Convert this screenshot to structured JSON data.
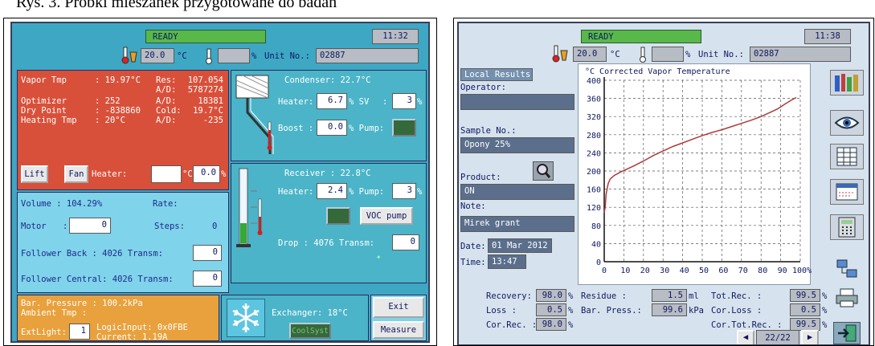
{
  "caption": "Rys. 3. Próbki mieszanek przygotowane do badań",
  "left_screen": {
    "status": "READY",
    "time": "11:32",
    "temperature": "20.0",
    "temp_unit": "°C",
    "humidity_unit": "%",
    "unit_no_label": "Unit No.:",
    "unit_no": "02887",
    "red_panel": {
      "rows": [
        {
          "label": "Vapor Tmp",
          "v1": ": 19.97°C",
          "k2": "Res:",
          "v2": "107.054"
        },
        {
          "label": "",
          "v1": "",
          "k2": "A/D:",
          "v2": "5787274"
        },
        {
          "label": "Optimizer",
          "v1": ": 252",
          "k2": "A/D:",
          "v2": "18381"
        },
        {
          "label": "Dry Point",
          "v1": ": -838860",
          "k2": "Cold:",
          "v2": "19.7°C"
        },
        {
          "label": "Heating Tmp",
          "v1": ": 20°C",
          "k2": "A/D:",
          "v2": "-235"
        }
      ],
      "lift_label": "Lift",
      "fan_label": "Fan",
      "heater_label": "Heater:",
      "heater_value": "",
      "heater_unit": "°C",
      "heater_pct": "0.0",
      "pct_unit": "%"
    },
    "condenser": {
      "title": "Condenser: 22.7°C",
      "heater_label": "Heater:",
      "heater_value": "6.7",
      "sv_label": "% SV",
      "sv_value": "3",
      "boost_label": "Boost :",
      "boost_value": "0.0",
      "pump_label": "% Pump:",
      "pct": "%"
    },
    "receiver": {
      "title": "Receiver : 22.8°C",
      "heater_label": "Heater:",
      "heater_value": "2.4",
      "pump_label": "% Pump:",
      "pump_value": "3",
      "pct": "%",
      "voc_label": "VOC pump",
      "drop_label": "Drop : 4076 Transm:",
      "drop_value": "0"
    },
    "blue_panel": {
      "volume_label": "Volume : 104.29%",
      "rate_label": "Rate:",
      "motor_label": "Motor",
      "motor_value": "0",
      "steps_label": "Steps:",
      "steps_value": "0",
      "follower_back": "Follower Back : 4026 Transm:",
      "follower_back_value": "0",
      "follower_central": "Follower Central: 4026 Transm:",
      "follower_central_value": "0"
    },
    "orange_panel": {
      "pressure": "Bar. Pressure : 100.2kPa",
      "ambient": "Ambient Tmp :",
      "extlight_label": "ExtLight:",
      "extlight_value": "1",
      "logic": "LogicInput: 0x0FBE",
      "current": "Current: 1.19A"
    },
    "exchanger_label": "Exchanger: 18°C",
    "coolsyst_label": "CoolSyst",
    "exit_label": "Exit",
    "measure_label": "Measure"
  },
  "right_screen": {
    "status": "READY",
    "time": "11:38",
    "temperature": "20.0",
    "temp_unit": "°C",
    "humidity_unit": "%",
    "unit_no_label": "Unit No.:",
    "unit_no": "02887",
    "local_results": "Local Results:",
    "operator_label": "Operator:",
    "operator_value": "",
    "sample_label": "Sample No.:",
    "sample_value": "Opony 25%",
    "product_label": "Product:",
    "product_value": "ON",
    "note_label": "Note:",
    "note_value": "Mirek grant",
    "date_label": "Date:",
    "date_value": "01 Mar 2012",
    "time_label": "Time:",
    "time_value": "13:47",
    "results": {
      "recovery_label": "Recovery:",
      "recovery_value": "98.0",
      "residue_label": "Residue :",
      "residue_value": "1.5",
      "residue_unit": "ml",
      "tot_rec_label": "Tot.Rec. :",
      "tot_rec_value": "99.5",
      "loss_label": "Loss :",
      "loss_value": "0.5",
      "bar_press_label": "Bar. Press.:",
      "bar_press_value": "99.6",
      "bar_press_unit": "kPa",
      "cor_loss_label": "Cor.Loss :",
      "cor_loss_value": "0.5",
      "cor_rec_label": "Cor.Rec. :",
      "cor_rec_value": "98.0",
      "cor_tot_rec_label": "Cor.Tot.Rec. :",
      "cor_tot_rec_value": "99.5",
      "pct": "%"
    },
    "page_indicator": "22/22"
  },
  "chart_data": {
    "type": "line",
    "title": "°C Corrected    Vapor Temperature",
    "xlabel": "",
    "ylabel": "",
    "xlim": [
      0,
      100
    ],
    "ylim": [
      0,
      400
    ],
    "x_ticks": [
      0,
      10,
      20,
      30,
      40,
      50,
      60,
      70,
      80,
      90,
      100
    ],
    "x_tick_labels": [
      "0",
      "10",
      "20",
      "30",
      "40",
      "50",
      "60",
      "70",
      "80",
      "90",
      "100%"
    ],
    "y_ticks": [
      0,
      40,
      80,
      120,
      160,
      200,
      240,
      280,
      320,
      360,
      400
    ],
    "grid": true,
    "series": [
      {
        "color": "#b03a3a",
        "x": [
          0,
          0.5,
          1,
          2,
          3,
          5,
          8,
          10,
          15,
          20,
          25,
          30,
          35,
          40,
          45,
          50,
          55,
          60,
          65,
          70,
          75,
          80,
          85,
          88,
          90,
          92,
          95,
          97,
          98
        ],
        "y": [
          108,
          120,
          150,
          172,
          182,
          190,
          197,
          201,
          211,
          222,
          234,
          244,
          254,
          262,
          270,
          278,
          285,
          291,
          298,
          305,
          312,
          320,
          330,
          336,
          341,
          347,
          355,
          360,
          362
        ]
      }
    ]
  }
}
